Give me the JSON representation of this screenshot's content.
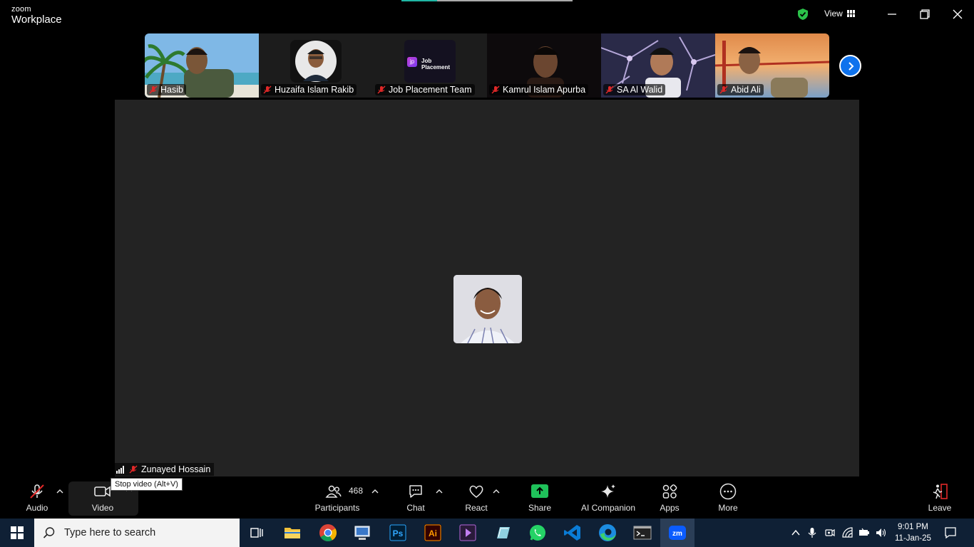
{
  "app": {
    "brand_top": "zoom",
    "brand_bottom": "Workplace"
  },
  "titlebar": {
    "view_label": "View"
  },
  "participants_strip": [
    {
      "name": "Hasib"
    },
    {
      "name": "Huzaifa Islam Rakib"
    },
    {
      "name": "Job Placement Team",
      "logo_text_1": "Job",
      "logo_text_2": "Placement"
    },
    {
      "name": "Kamrul Islam Apurba"
    },
    {
      "name": "SA Al Walid"
    },
    {
      "name": "Abid Ali"
    }
  ],
  "stage": {
    "speaker_name": "Zunayed Hossain"
  },
  "toolbar": {
    "audio": "Audio",
    "video": "Video",
    "video_tooltip": "Stop video (Alt+V)",
    "participants": "Participants",
    "participants_count": "468",
    "chat": "Chat",
    "react": "React",
    "share": "Share",
    "ai_companion": "AI Companion",
    "apps": "Apps",
    "more": "More",
    "leave": "Leave"
  },
  "taskbar": {
    "search_placeholder": "Type here to search",
    "time": "9:01 PM",
    "date": "11-Jan-25",
    "photoshop_label": "Ps",
    "illustrator_label": "Ai",
    "zoom_label": "zm"
  },
  "colors": {
    "accent_blue": "#0e72ed",
    "share_green": "#1fc15a",
    "shield_green": "#2bc24a",
    "muted_red": "#e02828",
    "taskbar": "#0f2035"
  }
}
